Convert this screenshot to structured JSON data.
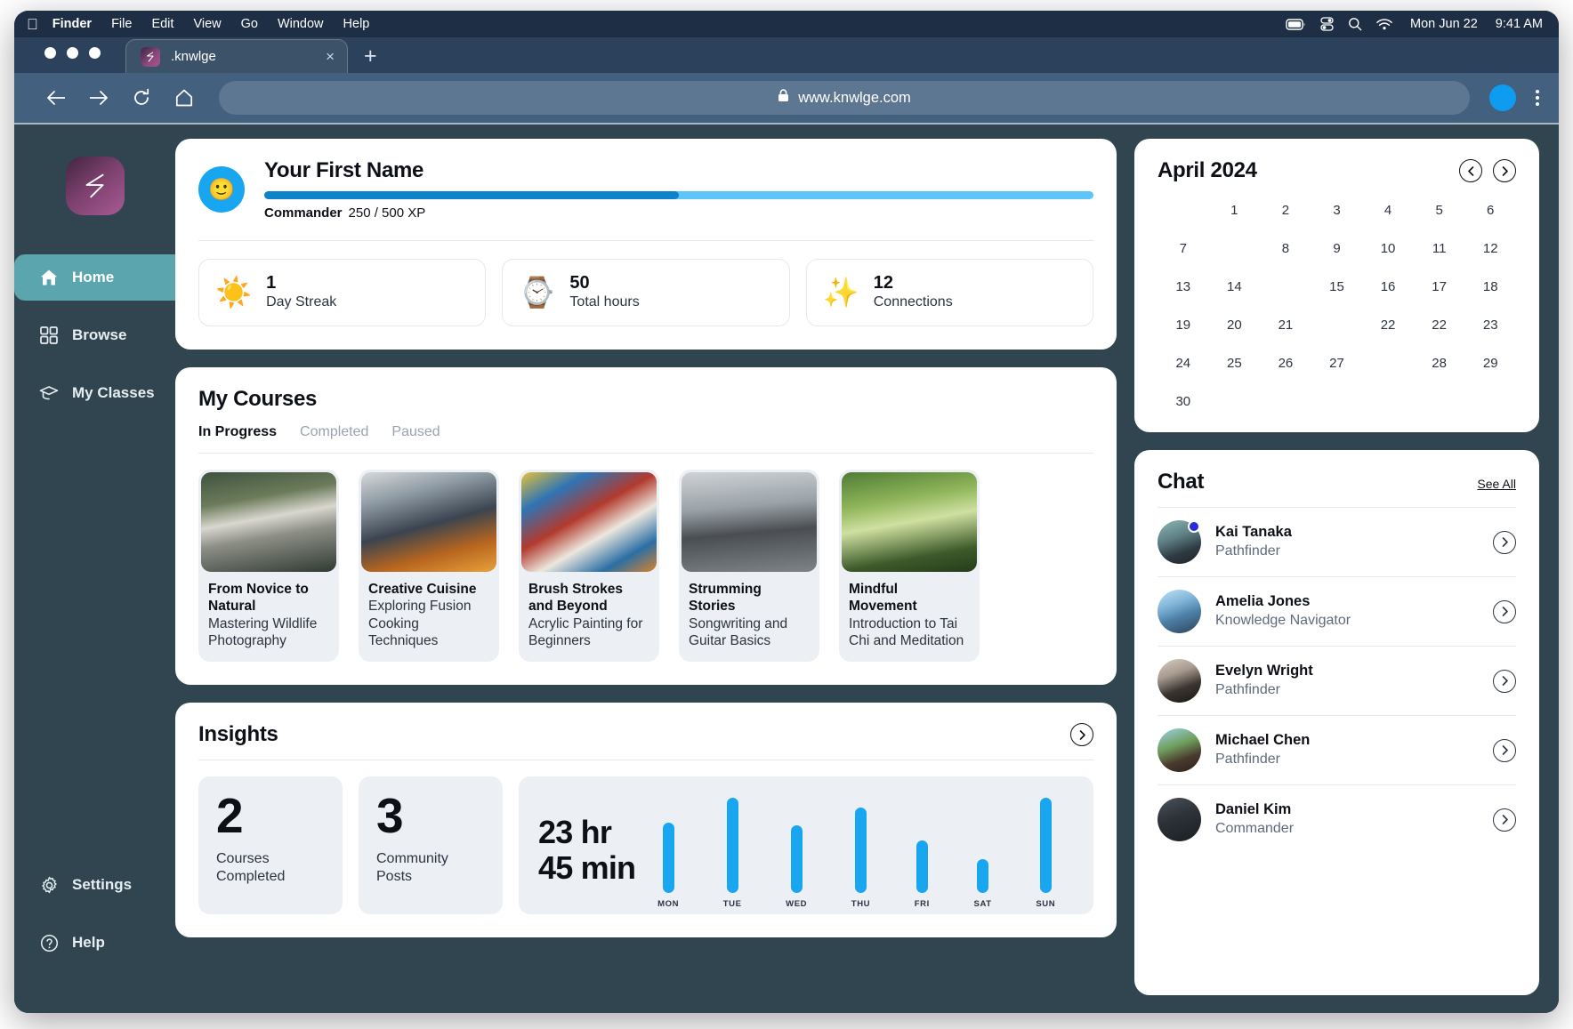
{
  "menubar": {
    "apple_icon": "apple-icon",
    "items": [
      "Finder",
      "File",
      "Edit",
      "View",
      "Go",
      "Window",
      "Help"
    ],
    "status_icons": [
      "battery-icon",
      "control-center-icon",
      "search-icon",
      "wifi-icon"
    ],
    "date": "Mon Jun 22",
    "time": "9:41 AM"
  },
  "browser": {
    "tab_title": ".knwlge",
    "tab_close": "×",
    "new_tab": "+",
    "url": "www.knwlge.com",
    "lock_icon": "lock-icon",
    "back_icon": "back-arrow-icon",
    "forward_icon": "forward-arrow-icon",
    "reload_icon": "reload-icon",
    "home_icon": "home-icon"
  },
  "sidebar": {
    "logo": "knwlge-logo",
    "items": [
      {
        "label": "Home",
        "icon": "home-icon",
        "active": true
      },
      {
        "label": "Browse",
        "icon": "grid-icon",
        "active": false
      },
      {
        "label": "My Classes",
        "icon": "graduation-cap-icon",
        "active": false
      }
    ],
    "bottom_items": [
      {
        "label": "Settings",
        "icon": "gear-icon"
      },
      {
        "label": "Help",
        "icon": "question-circle-icon"
      }
    ]
  },
  "profile": {
    "avatar_emoji": "🙂",
    "name": "Your First Name",
    "rank": "Commander",
    "xp_text": "250 / 500 XP",
    "xp_current": 250,
    "xp_total": 500,
    "xp_percent": 50,
    "bar_fill_color": "#0e83c9",
    "bar_track_color": "#5ec5fa",
    "stats": [
      {
        "emoji": "☀️",
        "icon": "sun-icon",
        "value": "1",
        "label": "Day Streak"
      },
      {
        "emoji": "⌚",
        "icon": "watch-icon",
        "value": "50",
        "label": "Total hours"
      },
      {
        "emoji": "✨",
        "icon": "sparkles-icon",
        "value": "12",
        "label": "Connections"
      }
    ]
  },
  "courses": {
    "title": "My Courses",
    "tabs": [
      {
        "label": "In Progress",
        "active": true
      },
      {
        "label": "Completed",
        "active": false
      },
      {
        "label": "Paused",
        "active": false
      }
    ],
    "items": [
      {
        "title": "From Novice to Natural",
        "subtitle": "Mastering Wildlife Photography",
        "image": "photographer-with-cockatoo"
      },
      {
        "title": "Creative Cuisine",
        "subtitle": "Exploring Fusion Cooking Techniques",
        "image": "couple-cooking-in-kitchen"
      },
      {
        "title": "Brush Strokes and Beyond",
        "subtitle": "Acrylic  Painting for Beginners",
        "image": "paint-bowls-and-brush"
      },
      {
        "title": "Strumming Stories",
        "subtitle": "Songwriting and Guitar Basics",
        "image": "man-writing-in-notebook"
      },
      {
        "title": "Mindful Movement",
        "subtitle": "Introduction to Tai Chi and Meditation",
        "image": "woman-doing-yoga-in-park"
      }
    ]
  },
  "insights": {
    "title": "Insights",
    "next_icon": "chevron-right-icon",
    "kpis": [
      {
        "value": "2",
        "label": "Courses Completed"
      },
      {
        "value": "3",
        "label": "Community Posts"
      }
    ],
    "total_time": "23 hr\n45 min",
    "total_time_line1": "23 hr",
    "total_time_line2": "45 min"
  },
  "chart_data": {
    "type": "bar",
    "title": "Weekly study time",
    "categories": [
      "MON",
      "TUE",
      "WED",
      "THU",
      "FRI",
      "SAT",
      "SUN"
    ],
    "values": [
      4.6,
      6.2,
      4.4,
      5.6,
      3.4,
      2.2,
      6.2
    ],
    "unit": "hours",
    "xlabel": "",
    "ylabel": "",
    "ylim": [
      0,
      6.5
    ],
    "grid": false,
    "legend": "none",
    "bar_color": "#19a6f0"
  },
  "calendar": {
    "month": "April 2024",
    "prev_icon": "chevron-left-circle-icon",
    "next_icon": "chevron-right-circle-icon",
    "weeks": [
      [
        "",
        "1",
        "2",
        "3",
        "4",
        "5",
        "6",
        "7"
      ],
      [
        "",
        "8",
        "9",
        "10",
        "11",
        "12",
        "13",
        "14"
      ],
      [
        "",
        "15",
        "16",
        "17",
        "18",
        "19",
        "20",
        "21"
      ],
      [
        "",
        "22",
        "22",
        "23",
        "24",
        "25",
        "26",
        "27"
      ],
      [
        "",
        "28",
        "29",
        "30",
        "",
        "",
        "",
        ""
      ]
    ],
    "days": [
      "1",
      "2",
      "3",
      "4",
      "5",
      "6",
      "7",
      "8",
      "9",
      "10",
      "11",
      "12",
      "13",
      "14",
      "15",
      "16",
      "17",
      "18",
      "19",
      "20",
      "21",
      "22",
      "22",
      "23",
      "24",
      "25",
      "26",
      "27",
      "28",
      "29",
      "30"
    ]
  },
  "chat": {
    "title": "Chat",
    "see_all": "See All",
    "chevron_icon": "chevron-right-circle-icon",
    "contacts": [
      {
        "name": "Kai Tanaka",
        "role": "Pathfinder",
        "online": true,
        "avatar": "man-in-cap-outdoors"
      },
      {
        "name": "Amelia Jones",
        "role": "Knowledge Navigator",
        "online": false,
        "avatar": "woman-on-mountain"
      },
      {
        "name": "Evelyn Wright",
        "role": "Pathfinder",
        "online": false,
        "avatar": "woman-with-glasses"
      },
      {
        "name": "Michael Chen",
        "role": "Pathfinder",
        "online": false,
        "avatar": "man-with-beard-outdoors"
      },
      {
        "name": "Daniel Kim",
        "role": "Commander",
        "online": false,
        "avatar": "man-in-suit-dark-bg"
      }
    ]
  },
  "colors": {
    "accent_blue": "#19a6f0",
    "sidebar_bg": "#30454f",
    "sidebar_active": "#5aa5ae",
    "menubar_bg": "#1d2e45",
    "urlbar_bg": "#43607f",
    "card_bg": "#ffffff",
    "tile_bg": "#eceff4"
  }
}
